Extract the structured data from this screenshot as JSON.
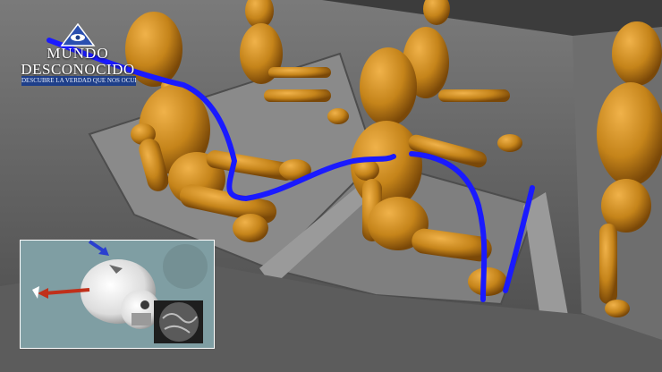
{
  "watermark": {
    "line1": "MUNDO",
    "line2": "DESCONOCIDO",
    "tagline": "DESCUBRE LA VERDAD QUE NOS OCULTAN",
    "brand_color": "#1e3f8a"
  },
  "scene": {
    "description_figures": 7,
    "mannequin_color": "#c8861a",
    "nerve_path_color": "#1a1aff",
    "floor_color": "#6b6b6b"
  },
  "inset": {
    "background": "#7f9ea3",
    "arrow_blue": "#2a3fcf",
    "arrow_red": "#c0301a"
  }
}
